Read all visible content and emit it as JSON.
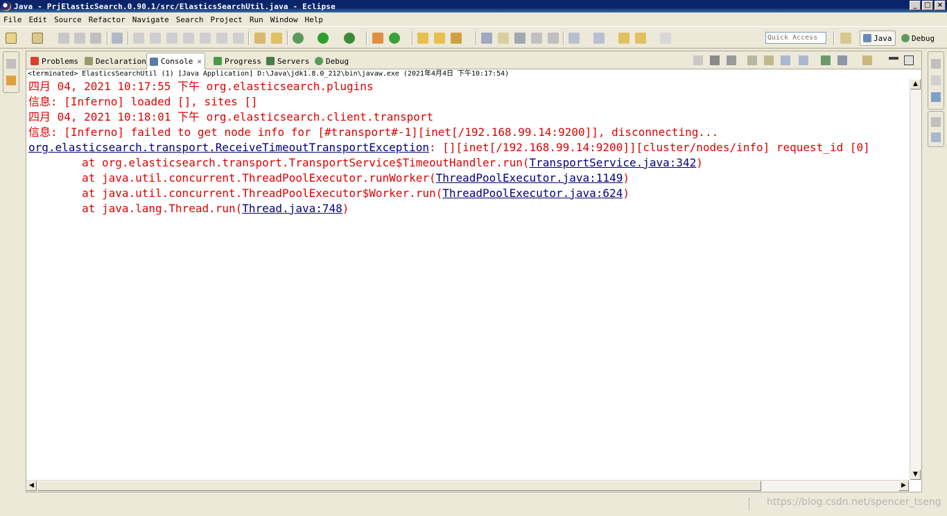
{
  "window": {
    "title": "Java - PrjElasticSearch.0.90.1/src/ElasticsSearchUtil.java - Eclipse",
    "buttons": {
      "minimize": "_",
      "maximize": "□",
      "close": "×"
    }
  },
  "menu": [
    "File",
    "Edit",
    "Source",
    "Refactor",
    "Navigate",
    "Search",
    "Project",
    "Run",
    "Window",
    "Help"
  ],
  "toolbar": {
    "quick_access_placeholder": "Quick Access",
    "perspectives": [
      {
        "label": "Java",
        "active": true
      },
      {
        "label": "Debug",
        "active": false
      }
    ]
  },
  "view": {
    "tabs": [
      {
        "label": "Problems",
        "icon": "problems-icon",
        "active": false
      },
      {
        "label": "Declaration",
        "icon": "declaration-icon",
        "active": false
      },
      {
        "label": "Console",
        "icon": "console-icon",
        "active": true
      },
      {
        "label": "Progress",
        "icon": "progress-icon",
        "active": false
      },
      {
        "label": "Servers",
        "icon": "servers-icon",
        "active": false
      },
      {
        "label": "Debug",
        "icon": "debug-icon",
        "active": false
      }
    ],
    "status": "<terminated> ElasticsSearchUtil (1) [Java Application] D:\\Java\\jdk1.8.0_212\\bin\\javaw.exe (2021年4月4日 下午10:17:54)"
  },
  "console": {
    "lines": [
      {
        "text": "四月 04, 2021 10:17:55 下午 org.elasticsearch.plugins"
      },
      {
        "text": "信息: [Inferno] loaded [], sites []"
      },
      {
        "text": "四月 04, 2021 10:18:01 下午 org.elasticsearch.client.transport"
      },
      {
        "text": "信息: [Inferno] failed to get node info for [#transport#-1][inet[/192.168.99.14:9200]], disconnecting..."
      },
      {
        "link": "org.elasticsearch.transport.ReceiveTimeoutTransportException",
        "after": ": [][inet[/192.168.99.14:9200]][cluster/nodes/info] request_id [0]"
      },
      {
        "before": "        at org.elasticsearch.transport.TransportService$TimeoutHandler.run(",
        "link": "TransportService.java:342",
        "after": ")"
      },
      {
        "before": "        at java.util.concurrent.ThreadPoolExecutor.runWorker(",
        "link": "ThreadPoolExecutor.java:1149",
        "after": ")"
      },
      {
        "before": "        at java.util.concurrent.ThreadPoolExecutor$Worker.run(",
        "link": "ThreadPoolExecutor.java:624",
        "after": ")"
      },
      {
        "before": "        at java.lang.Thread.run(",
        "link": "Thread.java:748",
        "after": ")"
      }
    ]
  },
  "watermark": "https://blog.csdn.net/spencer_tseng",
  "colors": {
    "error_text": "#e00000",
    "link": "#000080",
    "titlebar": "#0a246a"
  }
}
